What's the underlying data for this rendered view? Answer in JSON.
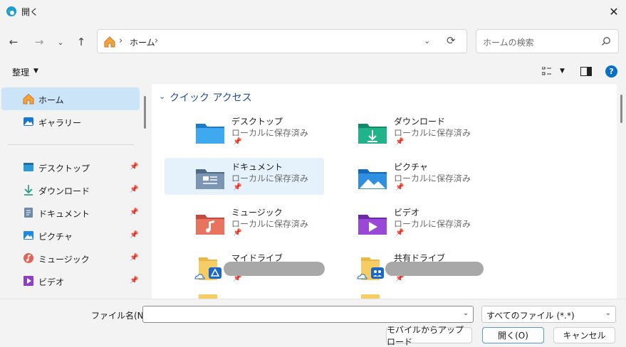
{
  "window": {
    "title": "開く"
  },
  "nav": {
    "back_icon": "back-arrow-icon",
    "forward_icon": "forward-arrow-icon",
    "recent_icon": "chevron-down-icon",
    "up_icon": "up-arrow-icon"
  },
  "address": {
    "location": "ホーム"
  },
  "search": {
    "placeholder": "ホームの検索"
  },
  "toolbar": {
    "organize_label": "整理",
    "help_label": "?"
  },
  "sidebar": {
    "items": [
      {
        "label": "ホーム",
        "icon": "home-icon",
        "active": true
      },
      {
        "label": "ギャラリー",
        "icon": "gallery-icon"
      },
      {
        "label": "デスクトップ",
        "icon": "desktop-icon",
        "pinned": true
      },
      {
        "label": "ダウンロード",
        "icon": "download-icon",
        "pinned": true
      },
      {
        "label": "ドキュメント",
        "icon": "document-icon",
        "pinned": true
      },
      {
        "label": "ピクチャ",
        "icon": "pictures-icon",
        "pinned": true
      },
      {
        "label": "ミュージック",
        "icon": "music-icon",
        "pinned": true
      },
      {
        "label": "ビデオ",
        "icon": "video-icon",
        "pinned": true
      }
    ]
  },
  "quick_access": {
    "title": "クイック アクセス",
    "items": [
      {
        "name": "デスクトップ",
        "sub": "ローカルに保存済み",
        "icon": "desktop-folder-icon"
      },
      {
        "name": "ダウンロード",
        "sub": "ローカルに保存済み",
        "icon": "downloads-folder-icon"
      },
      {
        "name": "ドキュメント",
        "sub": "ローカルに保存済み",
        "icon": "documents-folder-icon",
        "selected": true
      },
      {
        "name": "ピクチャ",
        "sub": "ローカルに保存済み",
        "icon": "pictures-folder-icon"
      },
      {
        "name": "ミュージック",
        "sub": "ローカルに保存済み",
        "icon": "music-folder-icon"
      },
      {
        "name": "ビデオ",
        "sub": "ローカルに保存済み",
        "icon": "videos-folder-icon"
      },
      {
        "name": "マイドライブ",
        "sub": "",
        "icon": "google-drive-folder-icon"
      },
      {
        "name": "共有ドライブ",
        "sub": "",
        "icon": "shared-drive-folder-icon"
      }
    ]
  },
  "footer": {
    "filename_label": "ファイル名(N):",
    "filename_value": "",
    "filetype_value": "すべてのファイル (*.*)",
    "mobile_upload_label": "モバイルからアップロード",
    "open_label": "開く(O)",
    "cancel_label": "キャンセル"
  },
  "colors": {
    "accent": "#0a6ec7",
    "selection": "#cce4f7",
    "hover": "#e5f1fb"
  }
}
